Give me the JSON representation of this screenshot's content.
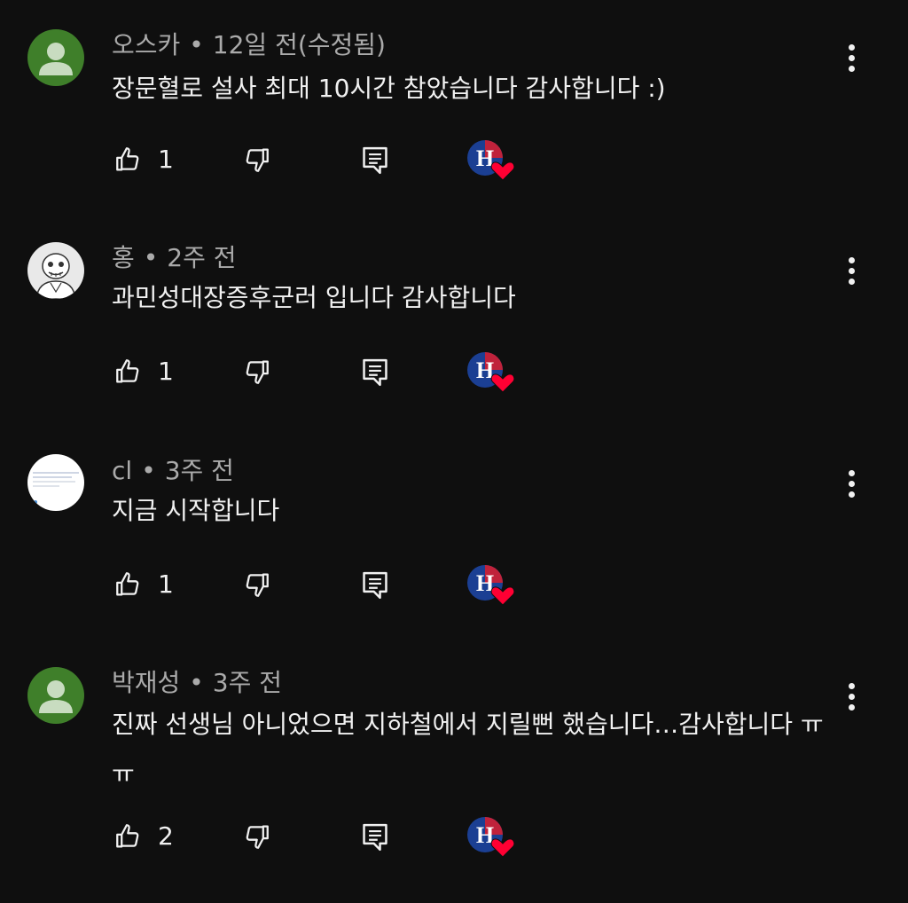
{
  "colors": {
    "background": "#0f0f0f",
    "text": "#f1f1f1",
    "muted": "#aaaaaa",
    "default_avatar_bg": "#3f7f2a",
    "heart": "#ff0033"
  },
  "separator": "•",
  "comments": [
    {
      "author": "오스카",
      "time": "12일 전(수정됨)",
      "text": "장문혈로 설사 최대 10시간 참았습니다 감사합니다 :)",
      "likes": "1",
      "avatar_icon": "default-person-avatar",
      "creator_heart": true
    },
    {
      "author": "홍",
      "time": "2주 전",
      "text": "과민성대장증후군러 입니다 감사합니다",
      "likes": "1",
      "avatar_icon": "skeleton-character-avatar",
      "creator_heart": true
    },
    {
      "author": "cl",
      "time": "3주 전",
      "text": "지금 시작합니다",
      "likes": "1",
      "avatar_icon": "document-screenshot-avatar",
      "creator_heart": true
    },
    {
      "author": "박재성",
      "time": "3주 전",
      "text": "진짜 선생님 아니었으면 지하철에서 지릴뻔 했습니다…감사합니다 ㅠㅠ",
      "likes": "2",
      "avatar_icon": "default-person-avatar",
      "creator_heart": true
    }
  ],
  "channel_badge_letter": "H"
}
